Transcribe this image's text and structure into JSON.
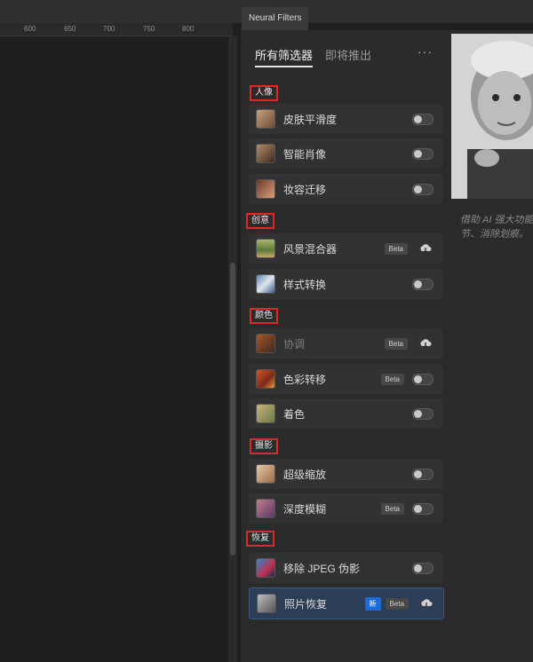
{
  "window": {
    "panel_tab_title": "Neural Filters"
  },
  "ruler": {
    "ticks": [
      "600",
      "650",
      "700",
      "750",
      "800"
    ]
  },
  "panel": {
    "tabs": [
      {
        "label": "所有筛选器",
        "active": true
      },
      {
        "label": "即将推出",
        "active": false
      }
    ],
    "more_label": "···",
    "sections": [
      {
        "label": "人像",
        "items": [
          {
            "label": "皮肤平滑度",
            "control": "toggle",
            "icon": "portrait-thumb"
          },
          {
            "label": "智能肖像",
            "control": "toggle",
            "icon": "portrait-thumb"
          },
          {
            "label": "妆容迁移",
            "control": "toggle",
            "icon": "portrait-thumb"
          }
        ]
      },
      {
        "label": "创意",
        "items": [
          {
            "label": "风景混合器",
            "badge": "Beta",
            "control": "cloud-download",
            "icon": "landscape-thumb"
          },
          {
            "label": "样式转换",
            "control": "toggle",
            "icon": "style-thumb"
          }
        ]
      },
      {
        "label": "颜色",
        "items": [
          {
            "label": "协调",
            "badge": "Beta",
            "control": "cloud-download",
            "icon": "color-thumb",
            "dimmed": true
          },
          {
            "label": "色彩转移",
            "badge": "Beta",
            "control": "toggle",
            "icon": "color-thumb"
          },
          {
            "label": "着色",
            "control": "toggle",
            "icon": "color-thumb"
          }
        ]
      },
      {
        "label": "摄影",
        "items": [
          {
            "label": "超级缩放",
            "control": "toggle",
            "icon": "photo-thumb"
          },
          {
            "label": "深度模糊",
            "badge": "Beta",
            "control": "toggle",
            "icon": "photo-thumb"
          }
        ]
      },
      {
        "label": "恢复",
        "items": [
          {
            "label": "移除 JPEG 伪影",
            "control": "toggle",
            "icon": "restore-thumb"
          },
          {
            "label": "照片恢复",
            "new_badge": "新",
            "badge": "Beta",
            "control": "cloud-download",
            "icon": "restore-thumb",
            "selected": true
          }
        ]
      }
    ]
  },
  "preview": {
    "description_line1": "借助 AI 强大功能",
    "description_line2": "节、消除划痕。"
  },
  "colors": {
    "accent": "#1d6bd8",
    "highlight_border": "#d92b2b",
    "selected_row": "#2c3e55"
  }
}
